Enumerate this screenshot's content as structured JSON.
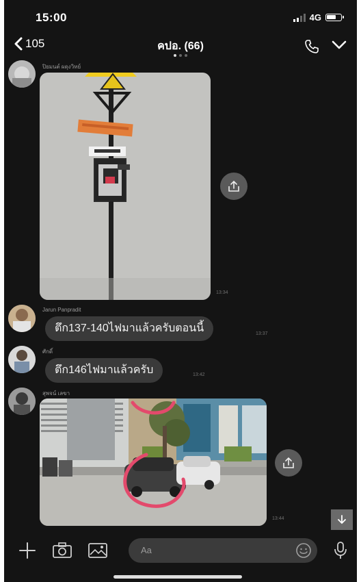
{
  "status_bar": {
    "time": "15:00",
    "network": "4G"
  },
  "header": {
    "back_count": "105",
    "title": "คปอ. (66)",
    "page_dots": 3,
    "active_dot": 0
  },
  "messages": [
    {
      "sender": "ปิยมนต์ ผดุงวิทย์",
      "type": "image",
      "timestamp": "13:34"
    },
    {
      "sender": "Jarun Panpradit",
      "type": "text",
      "text": "ตึก137-140ไฟมาแล้วครับตอนนี้",
      "timestamp": "13:37"
    },
    {
      "sender": "ศักดิ์",
      "type": "text",
      "text": "ตึก146ไฟมาแล้วครับ",
      "timestamp": "13:42"
    },
    {
      "sender": "สุพจน์ เลขา",
      "type": "image",
      "timestamp": "13:44"
    }
  ],
  "input": {
    "placeholder": "Aa"
  },
  "icons": {
    "back": "chevron-left-icon",
    "call": "phone-icon",
    "menu": "chevron-down-icon",
    "share": "share-icon",
    "scroll": "arrow-down-icon",
    "add": "plus-icon",
    "camera": "camera-icon",
    "gallery": "image-icon",
    "emoji": "smiley-icon",
    "mic": "microphone-icon"
  }
}
